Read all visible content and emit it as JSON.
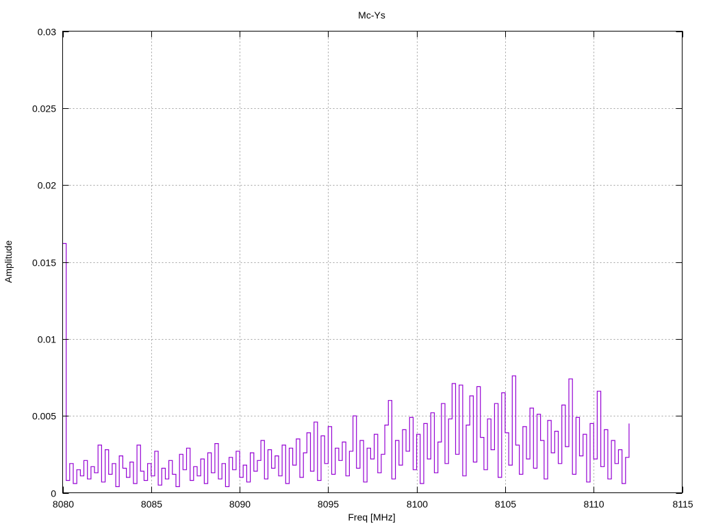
{
  "chart_data": {
    "type": "line",
    "title": "Mc-Ys",
    "xlabel": "Freq [MHz]",
    "ylabel": "Amplitude",
    "xlim": [
      8080,
      8115
    ],
    "ylim": [
      0,
      0.03
    ],
    "grid": true,
    "xticks": [
      "8080",
      "8085",
      "8090",
      "8095",
      "8100",
      "8105",
      "8110",
      "8115"
    ],
    "yticks": [
      "0",
      "0.005",
      "0.01",
      "0.015",
      "0.02",
      "0.025",
      "0.03"
    ],
    "xtick_values": [
      8080,
      8085,
      8090,
      8095,
      8100,
      8105,
      8110,
      8115
    ],
    "ytick_values": [
      0,
      0.005,
      0.01,
      0.015,
      0.02,
      0.025,
      0.03
    ],
    "series": [
      {
        "name": "Mc-Ys",
        "color": "#9400d3",
        "x_start": 8080,
        "x_step": 0.2,
        "values": [
          0.0162,
          0.0008,
          0.0019,
          0.0006,
          0.0015,
          0.0011,
          0.0021,
          0.0009,
          0.0017,
          0.0013,
          0.0031,
          0.0007,
          0.0028,
          0.0012,
          0.0019,
          0.0004,
          0.0024,
          0.0016,
          0.001,
          0.002,
          0.0006,
          0.0031,
          0.0014,
          0.0008,
          0.0019,
          0.0011,
          0.0027,
          0.0005,
          0.0016,
          0.0009,
          0.0021,
          0.0012,
          0.0004,
          0.0025,
          0.0015,
          0.0029,
          0.0008,
          0.0017,
          0.0011,
          0.0022,
          0.0006,
          0.0026,
          0.0013,
          0.0032,
          0.0009,
          0.0019,
          0.0004,
          0.0023,
          0.0015,
          0.0027,
          0.001,
          0.0018,
          0.0007,
          0.0026,
          0.0014,
          0.0021,
          0.0034,
          0.0009,
          0.0028,
          0.0016,
          0.0024,
          0.0011,
          0.0031,
          0.0006,
          0.0029,
          0.0018,
          0.0035,
          0.001,
          0.0026,
          0.0039,
          0.0014,
          0.0046,
          0.0008,
          0.0037,
          0.0019,
          0.0043,
          0.0012,
          0.0029,
          0.0021,
          0.0033,
          0.0011,
          0.0027,
          0.005,
          0.0016,
          0.0034,
          0.0007,
          0.0029,
          0.0022,
          0.0038,
          0.0013,
          0.0025,
          0.0044,
          0.006,
          0.0009,
          0.0034,
          0.0018,
          0.0041,
          0.0027,
          0.0049,
          0.0015,
          0.0038,
          0.0006,
          0.0045,
          0.0022,
          0.0052,
          0.0013,
          0.0033,
          0.0058,
          0.0019,
          0.0048,
          0.0071,
          0.0025,
          0.007,
          0.0011,
          0.0044,
          0.0063,
          0.002,
          0.0069,
          0.0036,
          0.0015,
          0.0048,
          0.0028,
          0.0058,
          0.001,
          0.0065,
          0.0039,
          0.0018,
          0.0076,
          0.0031,
          0.0012,
          0.0043,
          0.0022,
          0.0055,
          0.0016,
          0.0051,
          0.0034,
          0.0009,
          0.0047,
          0.0026,
          0.004,
          0.0019,
          0.0057,
          0.003,
          0.0074,
          0.0012,
          0.0049,
          0.0024,
          0.0038,
          0.0007,
          0.0045,
          0.0022,
          0.0066,
          0.0017,
          0.0041,
          0.0009,
          0.0034,
          0.0019,
          0.0028,
          0.0006,
          0.0023,
          0.0045
        ]
      }
    ]
  }
}
